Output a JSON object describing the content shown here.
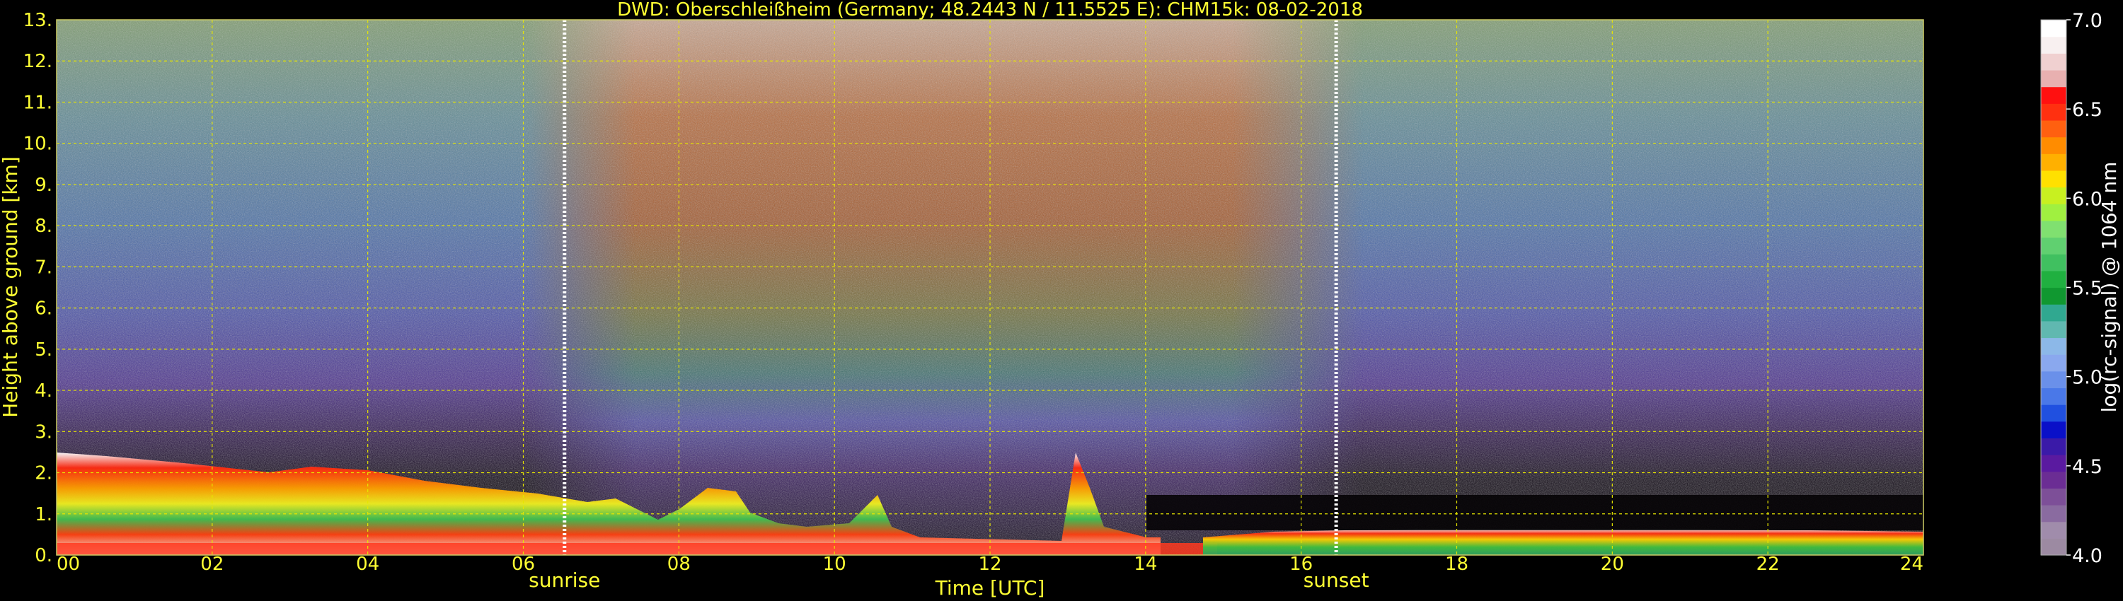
{
  "chart_data": {
    "type": "heatmap",
    "title": "DWD: Oberschleißheim (Germany; 48.2443 N / 11.5525 E):    CHM15k: 08-02-2018",
    "xlabel": "Time [UTC]",
    "ylabel": "Height above ground [km]",
    "xlim": [
      0,
      24
    ],
    "ylim": [
      0,
      13
    ],
    "x_ticks": [
      "00",
      "02",
      "04",
      "06",
      "08",
      "10",
      "12",
      "14",
      "16",
      "18",
      "20",
      "22",
      "24"
    ],
    "y_ticks": [
      "0.",
      "1.",
      "2.",
      "3.",
      "4.",
      "5.",
      "6.",
      "7.",
      "8.",
      "9.",
      "10.",
      "11.",
      "12.",
      "13."
    ],
    "grid": true,
    "markers": [
      {
        "label": "sunrise",
        "x": 6.53
      },
      {
        "label": "sunset",
        "x": 16.45
      }
    ],
    "colorbar": {
      "label": "log(rc-signal) @ 1064 nm",
      "range": [
        4.0,
        7.0
      ],
      "ticks": [
        "4.0",
        "4.5",
        "5.0",
        "5.5",
        "6.0",
        "6.5",
        "7.0"
      ],
      "colors": [
        "#9c8aa2",
        "#a08cab",
        "#8a6ba0",
        "#7d4f98",
        "#6b2d94",
        "#5a1aa0",
        "#3a1aa8",
        "#0a10c8",
        "#2050e0",
        "#4a78e8",
        "#6a90ea",
        "#8aa8ee",
        "#8cb8e8",
        "#60b8b0",
        "#30a890",
        "#109830",
        "#20b040",
        "#40c060",
        "#60d070",
        "#80e070",
        "#a0f040",
        "#c8f020",
        "#ffe000",
        "#ffb000",
        "#ff8c00",
        "#ff6010",
        "#ff3010",
        "#ff1010",
        "#e8b0b0",
        "#f0d0d0",
        "#f8f0f0",
        "#ffffff"
      ]
    }
  }
}
